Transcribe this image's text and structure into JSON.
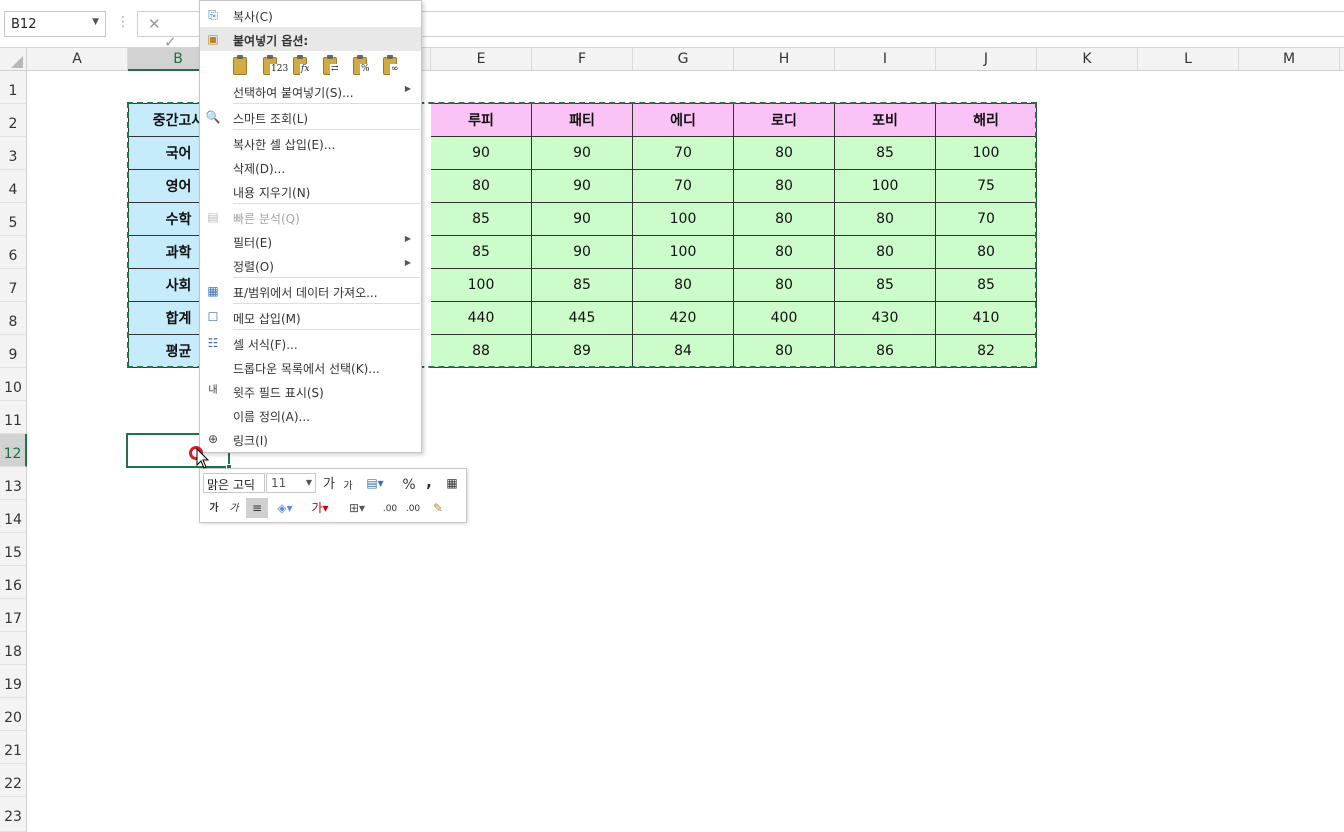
{
  "formula_bar": {
    "name_box": "B12",
    "cancel_icon": "✕",
    "enter_icon": "✓",
    "sep": "⋮"
  },
  "columns": [
    "A",
    "B",
    "C",
    "D",
    "E",
    "F",
    "G",
    "H",
    "I",
    "J",
    "K",
    "L",
    "M"
  ],
  "rows": [
    "1",
    "2",
    "3",
    "4",
    "5",
    "6",
    "7",
    "8",
    "9",
    "10",
    "11",
    "12",
    "13",
    "14",
    "15",
    "16",
    "17",
    "18",
    "19",
    "20",
    "21",
    "22",
    "23"
  ],
  "selected_cell": "B12",
  "table": {
    "corner_label": "중간고사",
    "header_visible": [
      "루피",
      "패티",
      "에디",
      "로디",
      "포비",
      "해리"
    ],
    "row_labels": [
      "국어",
      "영어",
      "수학",
      "과학",
      "사회",
      "합계",
      "평균"
    ],
    "values": [
      [
        "90",
        "90",
        "70",
        "80",
        "85",
        "100"
      ],
      [
        "80",
        "90",
        "70",
        "80",
        "100",
        "75"
      ],
      [
        "85",
        "90",
        "100",
        "80",
        "80",
        "70"
      ],
      [
        "85",
        "90",
        "100",
        "80",
        "80",
        "80"
      ],
      [
        "100",
        "85",
        "80",
        "80",
        "85",
        "85"
      ],
      [
        "440",
        "445",
        "420",
        "400",
        "430",
        "410"
      ],
      [
        "88",
        "89",
        "84",
        "80",
        "86",
        "82"
      ]
    ]
  },
  "context_menu": {
    "copy": "복사(C)",
    "paste_options": "붙여넣기 옵션:",
    "paste_special": "선택하여 붙여넣기(S)...",
    "smart_lookup": "스마트 조회(L)",
    "insert_copied": "복사한 셀 삽입(E)...",
    "delete": "삭제(D)...",
    "clear": "내용 지우기(N)",
    "quick_analysis": "빠른 분석(Q)",
    "filter": "필터(E)",
    "sort": "정렬(O)",
    "get_data": "표/범위에서 데이터 가져오...",
    "insert_comment": "메모 삽입(M)",
    "format_cells": "셀 서식(F)...",
    "pick_dropdown": "드롭다운 목록에서 선택(K)...",
    "phonetic": "윗주 필드 표시(S)",
    "define_name": "이름 정의(A)...",
    "link": "링크(I)",
    "paste_icon_overlays": [
      "",
      "123",
      "fx",
      "⇄",
      "%",
      "∞"
    ]
  },
  "mini_toolbar": {
    "font": "맑은 고딕",
    "size": "11",
    "grow": "가",
    "shrink": "가",
    "percent": "%",
    "comma": ",",
    "bold": "가",
    "italic": "가",
    "dec_inc": ".00",
    "dec_dec": ".00"
  },
  "colors": {
    "header_fill": "#fbc3f5",
    "label_fill": "#c6ebfa",
    "value_fill": "#ccfcca",
    "excel_green": "#217346"
  }
}
